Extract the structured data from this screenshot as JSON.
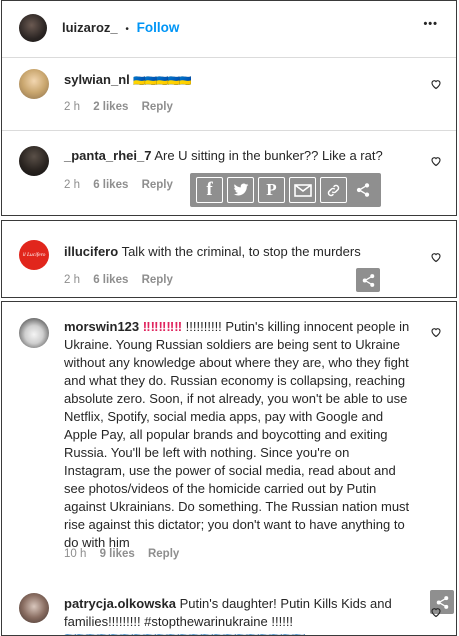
{
  "post_header": {
    "username": "luizaroz_",
    "dot": "•",
    "follow_label": "Follow",
    "more_label": "•••"
  },
  "comments": [
    {
      "username": "sylwian_nl",
      "text": "🇺🇦🇺🇦🇺🇦🇺🇦🇺🇦",
      "time": "2 h",
      "likes": "2 likes",
      "reply": "Reply"
    },
    {
      "username": "_panta_rhei_7",
      "text": "Are U sitting in the bunker?? Like a rat?",
      "time": "2 h",
      "likes": "6 likes",
      "reply": "Reply"
    },
    {
      "username": "illucifero",
      "text": "Talk with the criminal, to stop the murders",
      "time": "2 h",
      "likes": "6 likes",
      "reply": "Reply",
      "avatar_text": "il Lucifero"
    },
    {
      "username": "morswin123",
      "text_lines": [
        "!!!!!!!!!! Putin's killing innocent people in",
        "Ukraine. Young Russian soldiers are being sent to Ukraine",
        "without any knowledge about where they are, who they fight",
        "and what they do. Russian economy is collapsing, reaching",
        "absolute zero. Soon, if not already, you won't be able to use",
        "Netflix, Spotify, social media apps, pay with Google and",
        "Apple Pay, all popular brands and boycotting and exiting",
        "Russia. You'll be left with nothing. Since you're on",
        "Instagram, use the power of social media, read about and",
        "see photos/videos of the homicide carried out by Putin",
        "against Ukrainians. Do something. The Russian nation must",
        "rise against this dictator; you don't want to have anything to",
        "do with him"
      ],
      "time": "10 h",
      "likes": "9 likes",
      "reply": "Reply"
    },
    {
      "username": "patrycja.olkowska",
      "text_lines": [
        "Putin's daughter! Putin Kills Kids and",
        "families!!!!!!!!! #stopthewarinukraine !!!!!!"
      ],
      "flags": "🇺🇦🇺🇦🇺🇦🇺🇦🇺🇦🇺🇦🇺🇦🇺🇦🇺🇦🇺🇦🇺🇦🇺🇦🇺🇦🇺🇦🇺🇦🇺🇦🇺🇦🇺🇦🇺🇦🇺🇦🇺🇦"
    }
  ],
  "share_bar": {
    "icons": [
      "facebook-icon",
      "twitter-icon",
      "pinterest-icon",
      "email-icon",
      "link-icon",
      "share-icon"
    ],
    "fb": "f",
    "pin": "P"
  },
  "colors": {
    "follow": "#0095f6",
    "meta": "#8e8e8e",
    "share_bg": "#8f8f8f",
    "exclaim": "#e0245e"
  }
}
